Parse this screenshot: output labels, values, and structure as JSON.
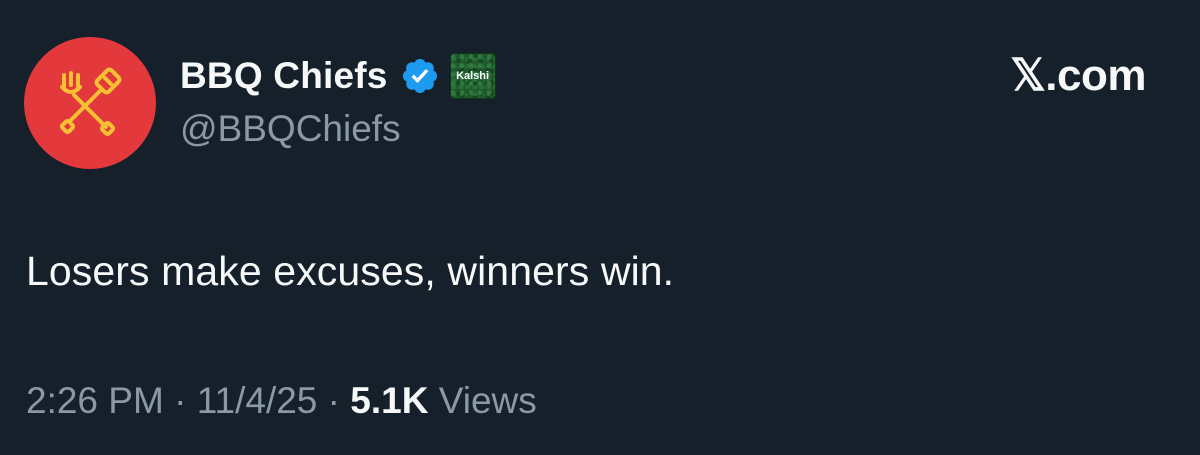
{
  "colors": {
    "background": "#15202b",
    "primary_text": "#f7f9f9",
    "secondary_text": "#8b98a5",
    "avatar_bg": "#e4393c",
    "avatar_icon": "#f5c132",
    "verified": "#1d9bf0",
    "affiliate_badge_bg": "#1f5a2d"
  },
  "author": {
    "display_name": "BBQ Chiefs",
    "handle": "@BBQChiefs",
    "avatar_icon": "crossed-fork-spatula-icon",
    "verified_icon": "verified-badge-icon",
    "affiliate_label": "Kalshi"
  },
  "site": {
    "logo": "𝕏.com"
  },
  "tweet": {
    "text": "Losers make excuses, winners win."
  },
  "meta": {
    "time": "2:26 PM",
    "separator": " · ",
    "date": "11/4/25",
    "views_count": "5.1K",
    "views_label": " Views"
  }
}
